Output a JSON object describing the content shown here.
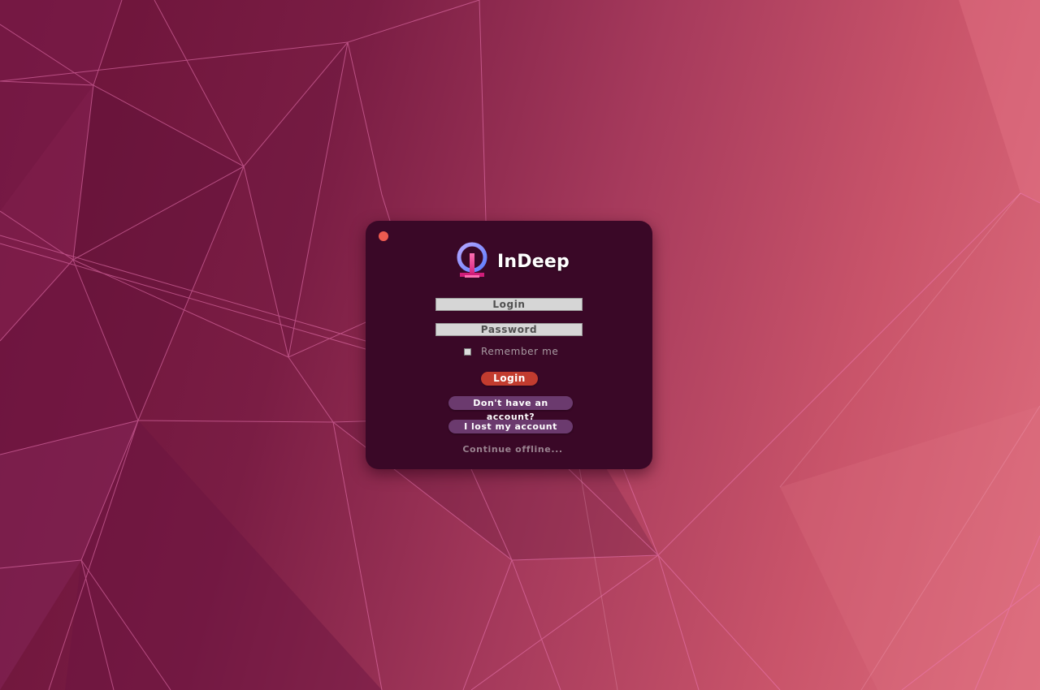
{
  "window": {
    "close_icon": "close-icon",
    "close_color": "#ee5b50",
    "background": "#3a0827"
  },
  "brand": {
    "logo_icon": "indeep-logo-icon",
    "name": "InDeep"
  },
  "form": {
    "login_placeholder": "Login",
    "login_value": "",
    "password_placeholder": "Password",
    "password_value": "",
    "remember_label": "Remember me",
    "remember_checked": false
  },
  "buttons": {
    "login": "Login",
    "login_color": "#c23c2f",
    "signup": "Don't have an account?",
    "lost_account": "I lost my account",
    "pill_color": "#6b3a6e"
  },
  "links": {
    "offline": "Continue offline..."
  }
}
